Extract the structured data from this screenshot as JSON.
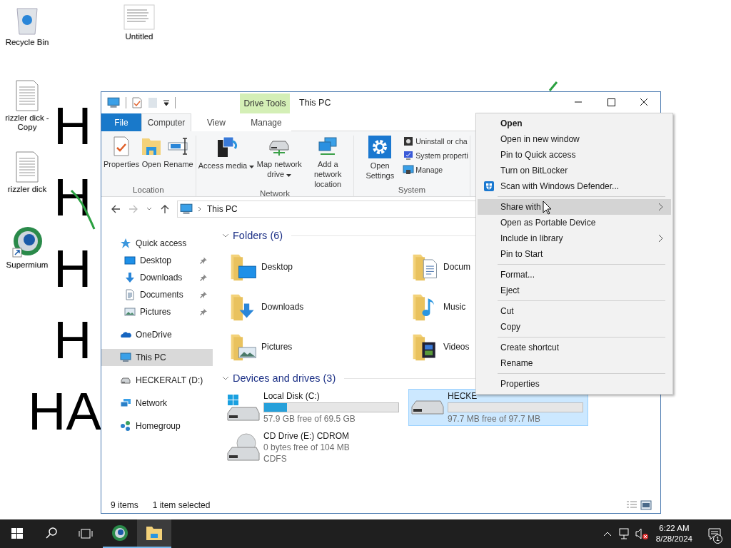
{
  "desktop": {
    "wallpaper_text": [
      "H",
      "H",
      "H",
      "H",
      "HA"
    ],
    "icons": [
      {
        "label": "Recycle Bin",
        "kind": "recycle"
      },
      {
        "label": "Untitled",
        "kind": "thumbnail"
      },
      {
        "label": "rizzler dick - Copy",
        "kind": "text-file"
      },
      {
        "label": "rizzler dick",
        "kind": "text-file"
      },
      {
        "label": "Supermium",
        "kind": "browser"
      }
    ]
  },
  "explorer": {
    "title": "This PC",
    "tool_context": "Drive Tools",
    "tabs": [
      {
        "label": "File",
        "kind": "file",
        "selected": false
      },
      {
        "label": "Computer",
        "kind": "tab",
        "selected": true
      },
      {
        "label": "View",
        "kind": "tab",
        "selected": false
      },
      {
        "label": "Manage",
        "kind": "tab",
        "selected": false
      }
    ],
    "ribbon": [
      {
        "label": "Location",
        "buttons": [
          {
            "label": "Properties",
            "kind": "properties",
            "dropdown": false
          },
          {
            "label": "Open",
            "kind": "open",
            "dropdown": false
          },
          {
            "label": "Rename",
            "kind": "rename",
            "dropdown": false
          }
        ]
      },
      {
        "label": "Network",
        "buttons": [
          {
            "label": "Access media",
            "kind": "media",
            "dropdown": true
          },
          {
            "label": "Map network drive",
            "kind": "map-drive",
            "dropdown": true
          },
          {
            "label": "Add a network location",
            "kind": "add-location",
            "dropdown": false
          }
        ]
      },
      {
        "label": "System",
        "buttons": [
          {
            "label": "Open Settings",
            "kind": "settings",
            "dropdown": false
          }
        ],
        "small_buttons": [
          {
            "label": "Uninstall or cha",
            "kind": "uninstall"
          },
          {
            "label": "System properti",
            "kind": "sysprops"
          },
          {
            "label": "Manage",
            "kind": "manage"
          }
        ]
      }
    ],
    "address": "This PC",
    "nav": [
      {
        "label": "Quick access",
        "kind": "star",
        "selected": false,
        "children": [
          {
            "label": "Desktop",
            "kind": "desktop",
            "pinned": true,
            "selected": false
          },
          {
            "label": "Downloads",
            "kind": "downloads",
            "pinned": true,
            "selected": false
          },
          {
            "label": "Documents",
            "kind": "documents",
            "pinned": true,
            "selected": false
          },
          {
            "label": "Pictures",
            "kind": "pictures",
            "pinned": true,
            "selected": false
          }
        ]
      },
      {
        "label": "OneDrive",
        "kind": "cloud",
        "selected": false
      },
      {
        "label": "This PC",
        "kind": "pc",
        "selected": true
      },
      {
        "label": "HECKERALT (D:)",
        "kind": "drive",
        "selected": false
      },
      {
        "label": "Network",
        "kind": "network",
        "selected": false
      },
      {
        "label": "Homegroup",
        "kind": "homegroup",
        "selected": false
      }
    ],
    "folders": {
      "title": "Folders (6)",
      "items": [
        {
          "label": "Desktop",
          "kind": "desktop"
        },
        {
          "label": "Docum",
          "kind": "documents"
        },
        {
          "label": "Downloads",
          "kind": "downloads"
        },
        {
          "label": "Music",
          "kind": "music"
        },
        {
          "label": "Pictures",
          "kind": "pictures"
        },
        {
          "label": "Videos",
          "kind": "videos"
        }
      ]
    },
    "drives": {
      "title": "Devices and drives (3)",
      "items": [
        {
          "label": "Local Disk (C:)",
          "kind": "system-disk",
          "level": 0.17,
          "detail": "57.9 GB free of 69.5 GB",
          "selected": false
        },
        {
          "label": "HECKE",
          "kind": "disk",
          "level": 0,
          "detail": "97.7 MB free of 97.7 MB",
          "selected": true
        },
        {
          "label": "CD Drive (E:) CDROM",
          "kind": "cd",
          "detail": "0 bytes free of 104 MB",
          "extra": "CDFS",
          "selected": false
        }
      ]
    },
    "status": {
      "count": "9 items",
      "selection": "1 item selected"
    }
  },
  "context_menu": {
    "groups": [
      [
        {
          "label": "Open",
          "kind": "default",
          "selected": false
        },
        {
          "label": "Open in new window",
          "kind": "plain",
          "selected": false
        },
        {
          "label": "Pin to Quick access",
          "kind": "plain",
          "selected": false
        },
        {
          "label": "Turn on BitLocker",
          "kind": "plain",
          "selected": false
        },
        {
          "label": "Scan with Windows Defender...",
          "kind": "shield",
          "selected": false
        }
      ],
      [
        {
          "label": "Share with",
          "kind": "submenu",
          "selected": true
        },
        {
          "label": "Open as Portable Device",
          "kind": "plain",
          "selected": false
        },
        {
          "label": "Include in library",
          "kind": "submenu",
          "selected": false
        },
        {
          "label": "Pin to Start",
          "kind": "plain",
          "selected": false
        }
      ],
      [
        {
          "label": "Format...",
          "kind": "plain",
          "selected": false
        },
        {
          "label": "Eject",
          "kind": "plain",
          "selected": false
        }
      ],
      [
        {
          "label": "Cut",
          "kind": "plain",
          "selected": false
        },
        {
          "label": "Copy",
          "kind": "plain",
          "selected": false
        }
      ],
      [
        {
          "label": "Create shortcut",
          "kind": "plain",
          "selected": false
        },
        {
          "label": "Rename",
          "kind": "plain",
          "selected": false
        }
      ],
      [
        {
          "label": "Properties",
          "kind": "plain",
          "selected": false
        }
      ]
    ]
  },
  "taskbar": {
    "apps": [
      {
        "kind": "browser",
        "selected": false
      },
      {
        "kind": "explorer",
        "selected": true
      }
    ],
    "time": "6:22 AM",
    "date": "8/28/2024",
    "notifications": "1"
  }
}
